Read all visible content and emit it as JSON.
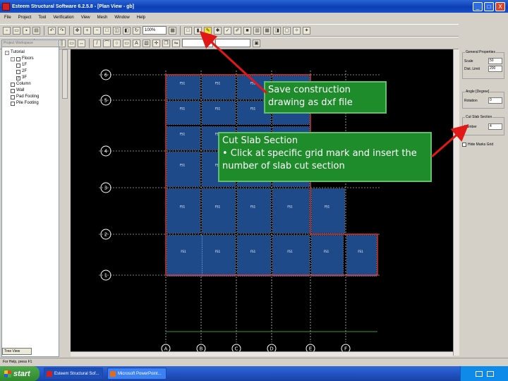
{
  "window": {
    "title": "Esteem Structural Software 6.2.5.8 - [Plan View - gb]",
    "buttons": [
      "_",
      "□",
      "X"
    ]
  },
  "menu": [
    "File",
    "Project",
    "Tool",
    "Verification",
    "View",
    "Mesh",
    "Window",
    "Help"
  ],
  "toolbar": {
    "zoom_value": "100%",
    "highlighted_tool": "save-dxf"
  },
  "left_panel": {
    "header": "Project Workspace",
    "tree": [
      {
        "label": "Tutorial",
        "level": 0,
        "expander": "-"
      },
      {
        "label": "Floors",
        "level": 1,
        "expander": "-",
        "checked": false
      },
      {
        "label": "1F",
        "level": 2,
        "checked": false
      },
      {
        "label": "2F",
        "level": 2,
        "checked": false
      },
      {
        "label": "3F",
        "level": 2,
        "checked": true
      },
      {
        "label": "Column",
        "level": 1,
        "checked": false
      },
      {
        "label": "Wall",
        "level": 1,
        "checked": false
      },
      {
        "label": "Pad Footing",
        "level": 1,
        "checked": false
      },
      {
        "label": "Pile Footing",
        "level": 1,
        "checked": false
      }
    ],
    "tab": "Tree View"
  },
  "right_panel": {
    "general_properties": {
      "title": "General Properties",
      "rows": [
        {
          "label": "Scale",
          "value": "50"
        },
        {
          "label": "Dist. Limit",
          "value": "200"
        }
      ]
    },
    "angle": {
      "title": "Angle [Degree]",
      "rows": [
        {
          "label": "Rotation",
          "value": "0"
        }
      ]
    },
    "cut_slab": {
      "title": "Cut Slab Section",
      "rows": [
        {
          "label": "Number",
          "value": "4"
        }
      ]
    },
    "checkbox_label": "Hide Marks Grid"
  },
  "status": "For Help, press F1",
  "taskbar": {
    "start": "start",
    "tasks": [
      "Esteem Structural Sof...",
      "Microsoft PowerPoint..."
    ]
  },
  "callouts": {
    "save": "Save construction drawing as dxf file",
    "cut_title": "Cut Slab Section",
    "cut_body": "• Click at specific grid mark and insert the number of slab cut section"
  },
  "drawing": {
    "row_marks": [
      "6",
      "5",
      "4",
      "3",
      "2",
      "1"
    ],
    "col_marks": [
      "A",
      "B",
      "C",
      "D",
      "E",
      "F"
    ],
    "slab_label": "FS1"
  },
  "colors": {
    "slab_fill": "#1e4a8a",
    "grid": "#ffffff",
    "beam_outline": "#e04040",
    "callout_bg": "#1f8c2c",
    "arrow": "#e01818"
  }
}
